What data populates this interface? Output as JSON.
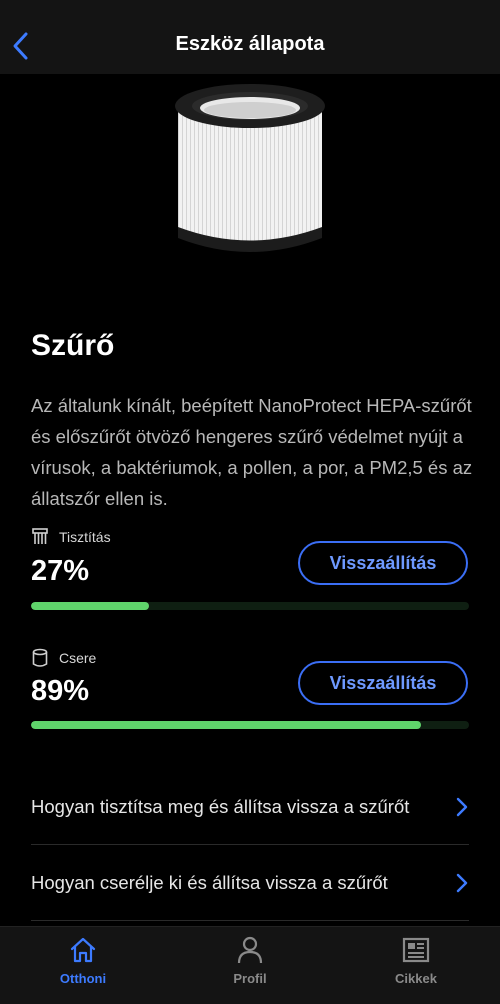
{
  "header": {
    "title": "Eszköz állapota"
  },
  "filter": {
    "title": "Szűrő",
    "description": "Az általunk kínált, beépített NanoProtect HEPA-szűrőt és előszűrőt ötvöző hengeres szűrő védelmet nyújt a vírusok, a baktériumok, a pollen, a por, a PM2,5 és az állatszőr ellen is."
  },
  "metrics": [
    {
      "label": "Tisztítás",
      "value": "27%",
      "progress": 0.27,
      "button": "Visszaállítás",
      "icon": "brush-icon"
    },
    {
      "label": "Csere",
      "value": "89%",
      "progress": 0.89,
      "button": "Visszaállítás",
      "icon": "cylinder-icon"
    }
  ],
  "links": [
    {
      "label": "Hogyan tisztítsa meg és állítsa vissza a szűrőt"
    },
    {
      "label": "Hogyan cserélje ki és állítsa vissza a szűrőt"
    }
  ],
  "tabs": [
    {
      "label": "Otthoni",
      "icon": "home-icon",
      "active": true
    },
    {
      "label": "Profil",
      "icon": "user-icon",
      "active": false
    },
    {
      "label": "Cikkek",
      "icon": "article-icon",
      "active": false
    }
  ],
  "colors": {
    "accent": "#3d7bff",
    "progress": "#5fd46b",
    "background": "#000000"
  }
}
